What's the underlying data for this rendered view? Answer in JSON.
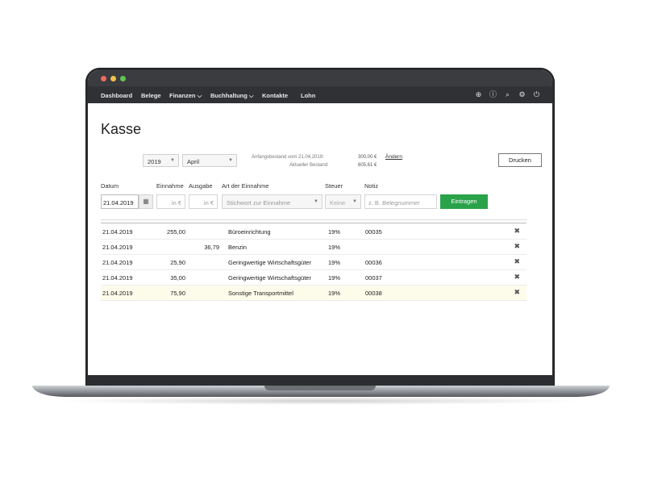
{
  "nav": {
    "items": [
      "Dashboard",
      "Belege",
      "Finanzen ⌵",
      "Buchhaltung ⌵",
      "Kontakte",
      "Lohn"
    ],
    "icons": [
      "plus-circle-icon",
      "help-icon",
      "search-icon",
      "gear-icon",
      "power-icon"
    ]
  },
  "page": {
    "title": "Kasse",
    "year_select": "2019",
    "month_select": "April",
    "opening_balance_label": "Anfangsbestand vom 21.04.2019:",
    "opening_balance_value": "300,00 €",
    "change_link": "Ändern",
    "current_balance_label": "Aktueller Bestand:",
    "current_balance_value": "605,61 €",
    "print_button": "Drucken"
  },
  "form": {
    "labels": {
      "date": "Datum",
      "income": "Einnahme",
      "expense": "Ausgabe",
      "type": "Art der Einnahme",
      "tax": "Steuer",
      "note": "Notiz"
    },
    "date_value": "21.04.2019",
    "income_placeholder": "in €",
    "expense_placeholder": "in €",
    "type_placeholder": "Stichwort zur Einnahme",
    "tax_placeholder": "Keine",
    "note_placeholder": "z. B. Belegnummer",
    "submit_button": "Eintragen"
  },
  "entries": [
    {
      "date": "21.04.2019",
      "income": "255,00",
      "expense": "",
      "type": "Büroeinrichtung",
      "tax": "19%",
      "note": "00035"
    },
    {
      "date": "21.04.2019",
      "income": "",
      "expense": "36,79",
      "type": "Benzin",
      "tax": "19%",
      "note": ""
    },
    {
      "date": "21.04.2019",
      "income": "25,90",
      "expense": "",
      "type": "Geringwertige Wirtschaftsgüter",
      "tax": "19%",
      "note": "00036"
    },
    {
      "date": "21.04.2019",
      "income": "35,00",
      "expense": "",
      "type": "Geringwertige Wirtschaftsgüter",
      "tax": "19%",
      "note": "00037"
    },
    {
      "date": "21.04.2019",
      "income": "75,90",
      "expense": "",
      "type": "Sonstige Transportmittel",
      "tax": "19%",
      "note": "00038"
    }
  ],
  "colors": {
    "accent": "#2aa24a",
    "navbar": "#2f3134",
    "highlight_row": "#fdfbea"
  }
}
